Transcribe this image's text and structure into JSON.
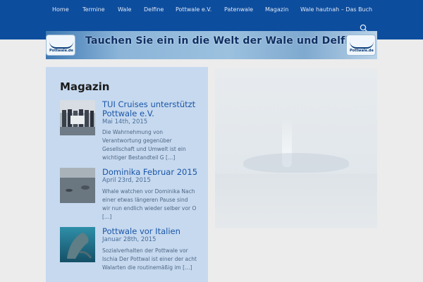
{
  "nav": {
    "items": [
      "Home",
      "Termine",
      "Wale",
      "Delfine",
      "Pottwale e.V.",
      "Patenwale",
      "Magazin",
      "Wale hautnah – Das Buch"
    ]
  },
  "banner": {
    "tagline": "Tauchen Sie ein in die Welt der Wale und Delfine",
    "logo_text": "Pottwale.de"
  },
  "sidebar": {
    "title": "Magazin",
    "articles": [
      {
        "title": "TUI Cruises unterstützt Pottwale e.V.",
        "date": "Mai 14th, 2015",
        "excerpt": "Die Wahrnehmung von Verantwortung gegenüber Gesellschaft und Umwelt ist ein wichtiger Bestandteil G […]"
      },
      {
        "title": "Dominika Februar 2015",
        "date": "April 23rd, 2015",
        "excerpt": "Whale watchen vor Dominika Nach einer etwas längeren Pause sind wir nun endlich wieder selber vor O […]"
      },
      {
        "title": "Pottwale vor Italien",
        "date": "Januar 28th, 2015",
        "excerpt": "Sozialverhalten der Pottwale vor Ischia Der Pottwal ist einer der acht Walarten die routinemäßig im […]"
      }
    ]
  },
  "colors": {
    "nav_bg": "#0d4d9e",
    "sidebar_bg": "#c6d9ef",
    "link": "#1a56a8"
  }
}
